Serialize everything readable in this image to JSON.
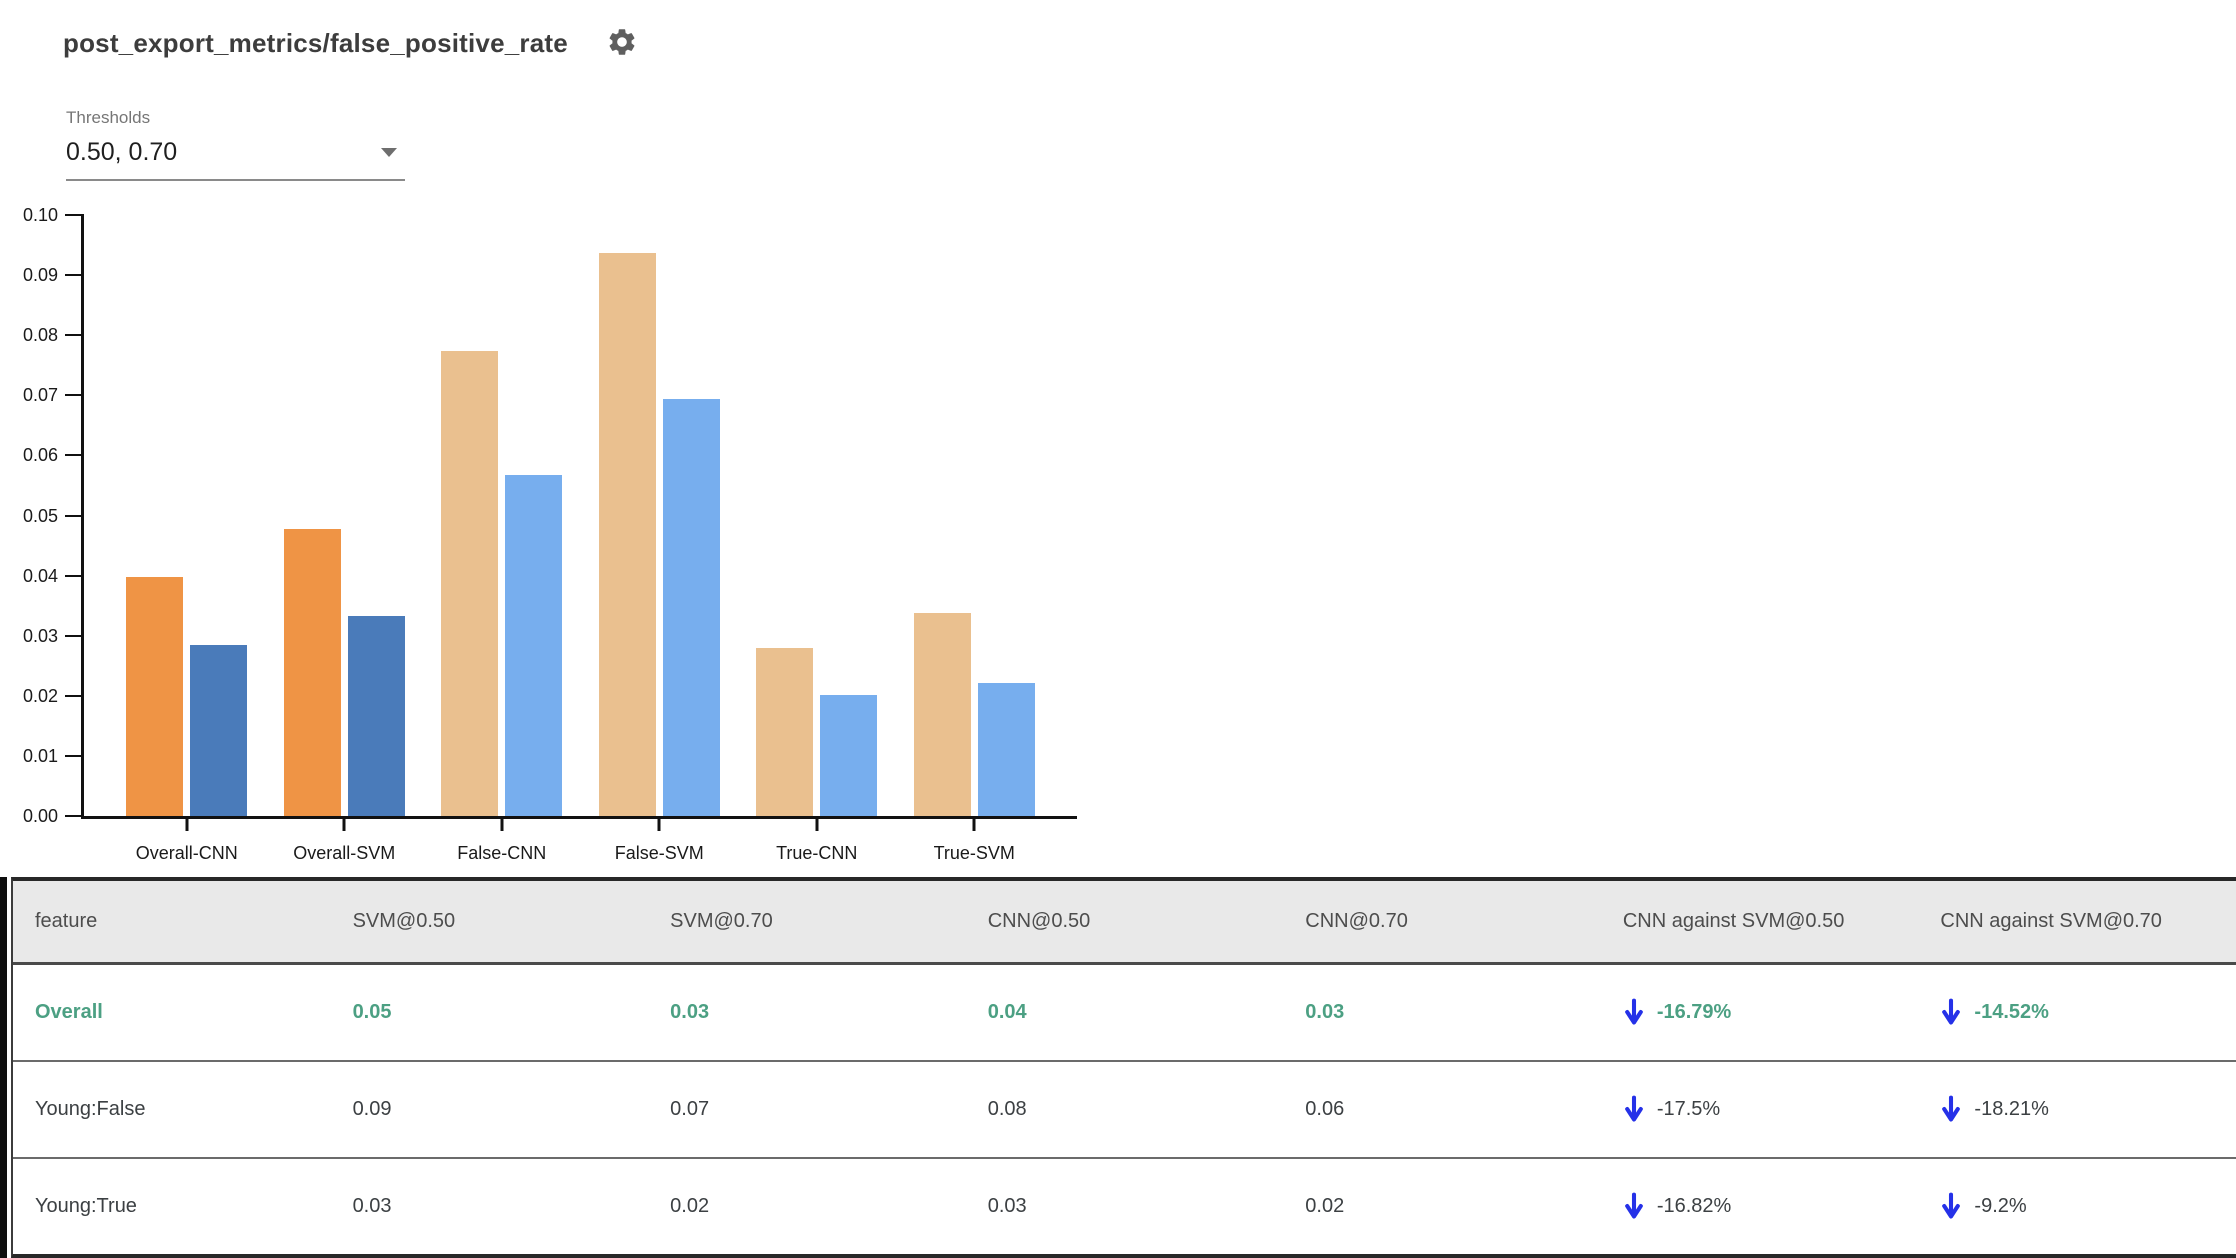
{
  "header": {
    "title": "post_export_metrics/false_positive_rate"
  },
  "controls": {
    "thresholds_label": "Thresholds",
    "thresholds_value": "0.50, 0.70"
  },
  "icons": {
    "gear": "⚙",
    "dropdown_caret": "▾",
    "down_arrow": "↓"
  },
  "colors": {
    "accent_green": "#4ca083",
    "arrow_blue": "#2531e8",
    "bar_orange": "#ef9445",
    "bar_dark_blue": "#4a7bba",
    "bar_tan": "#eac08f",
    "bar_light_blue": "#77aeee",
    "header_bg": "#e9e9e9"
  },
  "chart_data": {
    "type": "bar",
    "title": "",
    "xlabel": "",
    "ylabel": "",
    "ylim": [
      0,
      0.1
    ],
    "yticks": [
      "0.00",
      "0.01",
      "0.02",
      "0.03",
      "0.04",
      "0.05",
      "0.06",
      "0.07",
      "0.08",
      "0.09",
      "0.10"
    ],
    "grid": false,
    "legend": "none",
    "categories": [
      "Overall-CNN",
      "Overall-SVM",
      "False-CNN",
      "False-SVM",
      "True-CNN",
      "True-SVM"
    ],
    "series": [
      {
        "name": "threshold 0.50",
        "values": [
          0.0397,
          0.0477,
          0.0774,
          0.0937,
          0.0279,
          0.0337
        ],
        "colors": [
          "#ef9445",
          "#ef9445",
          "#eac08f",
          "#eac08f",
          "#eac08f",
          "#eac08f"
        ]
      },
      {
        "name": "threshold 0.70",
        "values": [
          0.0284,
          0.0332,
          0.0567,
          0.0694,
          0.0201,
          0.0221
        ],
        "colors": [
          "#4a7bba",
          "#4a7bba",
          "#77aeee",
          "#77aeee",
          "#77aeee",
          "#77aeee"
        ]
      }
    ]
  },
  "table": {
    "columns": [
      "feature",
      "SVM@0.50",
      "SVM@0.70",
      "CNN@0.50",
      "CNN@0.70",
      "CNN against SVM@0.50",
      "CNN against SVM@0.70"
    ],
    "rows": [
      {
        "feature": "Overall",
        "values": [
          "0.05",
          "0.03",
          "0.04",
          "0.03"
        ],
        "comparisons": [
          "-16.79%",
          "-14.52%"
        ],
        "highlight": true
      },
      {
        "feature": "Young:False",
        "values": [
          "0.09",
          "0.07",
          "0.08",
          "0.06"
        ],
        "comparisons": [
          "-17.5%",
          "-18.21%"
        ],
        "highlight": false
      },
      {
        "feature": "Young:True",
        "values": [
          "0.03",
          "0.02",
          "0.03",
          "0.02"
        ],
        "comparisons": [
          "-16.82%",
          "-9.2%"
        ],
        "highlight": false
      }
    ]
  }
}
